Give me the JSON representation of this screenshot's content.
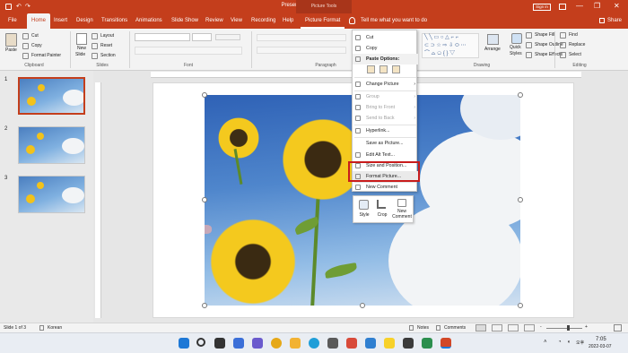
{
  "titlebar": {
    "title": "Presentation1 - PowerPoint",
    "context_label": "Picture Tools",
    "signin": "Sign in",
    "minimize": "—",
    "restore": "❐",
    "close": "✕"
  },
  "tabs": {
    "file": "File",
    "home": "Home",
    "insert": "Insert",
    "design": "Design",
    "transitions": "Transitions",
    "animations": "Animations",
    "slideshow": "Slide Show",
    "review": "Review",
    "view": "View",
    "recording": "Recording",
    "help": "Help",
    "picformat": "Picture Format",
    "tell": "Tell me what you want to do",
    "share": "Share"
  },
  "ribbon": {
    "clipboard": {
      "paste": "Paste",
      "cut": "Cut",
      "copy": "Copy",
      "painter": "Format Painter",
      "label": "Clipboard"
    },
    "slides": {
      "new": "New",
      "slide": "Slide",
      "layout": "Layout",
      "reset": "Reset",
      "section": "Section",
      "label": "Slides"
    },
    "font": {
      "label": "Font"
    },
    "paragraph": {
      "label": "Paragraph"
    },
    "drawing": {
      "arrange": "Arrange",
      "quick": "Quick",
      "styles": "Styles",
      "fill": "Shape Fill",
      "outline": "Shape Outline",
      "effects": "Shape Effects",
      "label": "Drawing"
    },
    "editing": {
      "find": "Find",
      "replace": "Replace",
      "select": "Select",
      "label": "Editing"
    }
  },
  "thumbnails": {
    "n1": "1",
    "n2": "2",
    "n3": "3"
  },
  "context_menu": {
    "cut": "Cut",
    "copy": "Copy",
    "paste_options": "Paste Options:",
    "change_picture": "Change Picture",
    "group": "Group",
    "bring_front": "Bring to Front",
    "send_back": "Send to Back",
    "hyperlink": "Hyperlink...",
    "save_as_picture": "Save as Picture...",
    "edit_alt": "Edit Alt Text...",
    "size_position": "Size and Position...",
    "format_picture": "Format Picture...",
    "new_comment": "New Comment"
  },
  "minibar": {
    "style": "Style",
    "crop": "Crop",
    "new_comment": "New Comment"
  },
  "status": {
    "slide": "Slide 1 of 3",
    "language": "Korean",
    "notes": "Notes",
    "comments": "Comments",
    "zoom_minus": "-",
    "zoom_plus": "+"
  },
  "taskbar": {
    "lang": "오후",
    "time": "7:05",
    "date": "2022-03-07"
  },
  "colors": {
    "brand": "#c43e1c",
    "highlight": "#c81c1c"
  }
}
